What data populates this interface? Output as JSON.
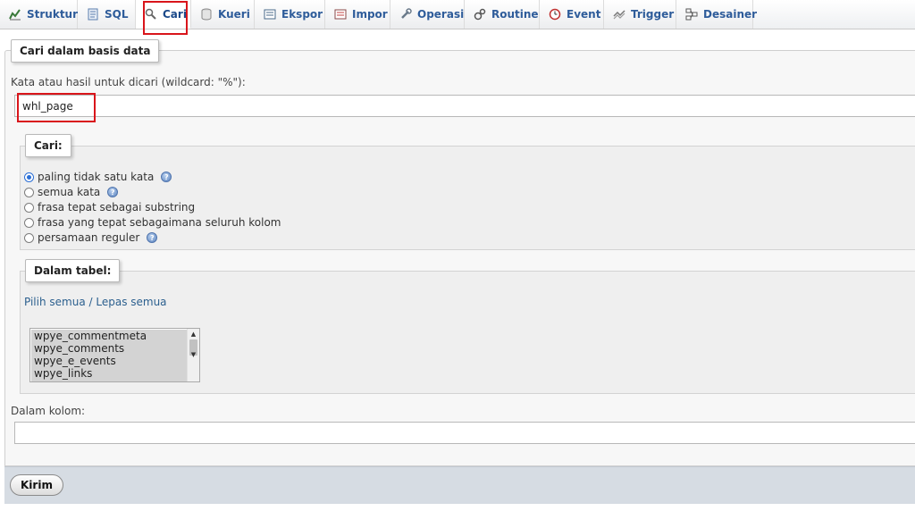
{
  "tabs": [
    {
      "label": "Struktur",
      "icon": "structure-icon"
    },
    {
      "label": "SQL",
      "icon": "sql-icon"
    },
    {
      "label": "Cari",
      "icon": "search-icon",
      "active": true
    },
    {
      "label": "Kueri",
      "icon": "query-icon"
    },
    {
      "label": "Ekspor",
      "icon": "export-icon"
    },
    {
      "label": "Impor",
      "icon": "import-icon"
    },
    {
      "label": "Operasi",
      "icon": "wrench-icon"
    },
    {
      "label": "Routine",
      "icon": "routine-icon"
    },
    {
      "label": "Event",
      "icon": "clock-icon"
    },
    {
      "label": "Trigger",
      "icon": "trigger-icon"
    },
    {
      "label": "Desainer",
      "icon": "designer-icon"
    }
  ],
  "search": {
    "legend": "Cari dalam basis data",
    "keyword_label": "Kata atau hasil untuk dicari (wildcard: \"%\"):",
    "keyword_value": "whl_page"
  },
  "mode": {
    "legend": "Cari:",
    "options": [
      {
        "label": "paling tidak satu kata",
        "checked": true,
        "help": true
      },
      {
        "label": "semua kata",
        "checked": false,
        "help": true
      },
      {
        "label": "frasa tepat sebagai substring",
        "checked": false,
        "help": false
      },
      {
        "label": "frasa yang tepat sebagaimana seluruh kolom",
        "checked": false,
        "help": false
      },
      {
        "label": "persamaan reguler",
        "checked": false,
        "help": true
      }
    ]
  },
  "tables": {
    "legend": "Dalam tabel:",
    "select_all": "Pilih semua",
    "separator": " / ",
    "deselect_all": "Lepas semua",
    "items": [
      "wpye_commentmeta",
      "wpye_comments",
      "wpye_e_events",
      "wpye_links"
    ]
  },
  "column": {
    "label": "Dalam kolom:",
    "value": ""
  },
  "submit_label": "Kirim",
  "colors": {
    "accent_highlight": "#d9151b",
    "tab_text": "#2e5c9a",
    "link": "#2b5f8e"
  }
}
